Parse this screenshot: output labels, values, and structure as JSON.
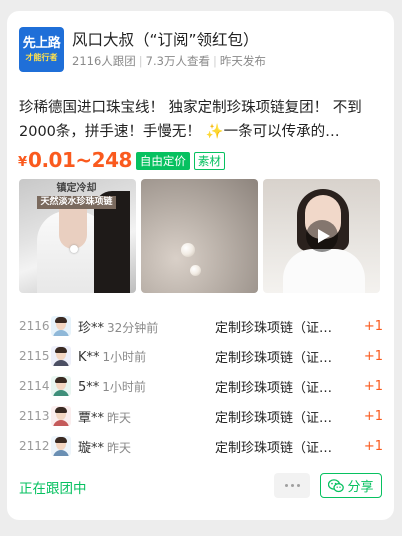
{
  "group": {
    "avatar_line1": "先上路",
    "avatar_line2": "才能行者",
    "title": "风口大叔（“订阅”领红包）",
    "followers": "2116人跟团",
    "views": "7.3万人查看",
    "posted": "昨天发布"
  },
  "post": {
    "description": "珍稀德国进口珠宝线！ 独家定制珍珠项链复团！ 不到2000条，拼手速！手慢无！ ✨一条可以传承的…",
    "currency": "¥",
    "price_range": "0.01~248",
    "tag_pricing": "自由定价",
    "tag_material": "素材"
  },
  "images": [
    {
      "overlay_line1": "镇定冷却",
      "overlay_line2": "天然淡水珍珠项链",
      "type": "photo"
    },
    {
      "type": "photo"
    },
    {
      "type": "video",
      "icon": "play-icon"
    }
  ],
  "orders": [
    {
      "number": "2116",
      "name": "珍**",
      "time": "32分钟前",
      "item": "定制珍珠项链（证…",
      "qty": "+1"
    },
    {
      "number": "2115",
      "name": "K**",
      "time": "1小时前",
      "item": "定制珍珠项链（证…",
      "qty": "+1"
    },
    {
      "number": "2114",
      "name": "5**",
      "time": "1小时前",
      "item": "定制珍珠项链（证…",
      "qty": "+1"
    },
    {
      "number": "2113",
      "name": "覃**",
      "time": "昨天",
      "item": "定制珍珠项链（证…",
      "qty": "+1"
    },
    {
      "number": "2112",
      "name": "璇**",
      "time": "昨天",
      "item": "定制珍珠项链（证…",
      "qty": "+1"
    }
  ],
  "footer": {
    "status": "正在跟团中",
    "more_icon": "more-dots-icon",
    "share_label": "分享",
    "share_icon": "wechat-icon"
  },
  "colors": {
    "accent_green": "#07c160",
    "price_orange": "#fa5a1e",
    "background": "#ededed"
  }
}
